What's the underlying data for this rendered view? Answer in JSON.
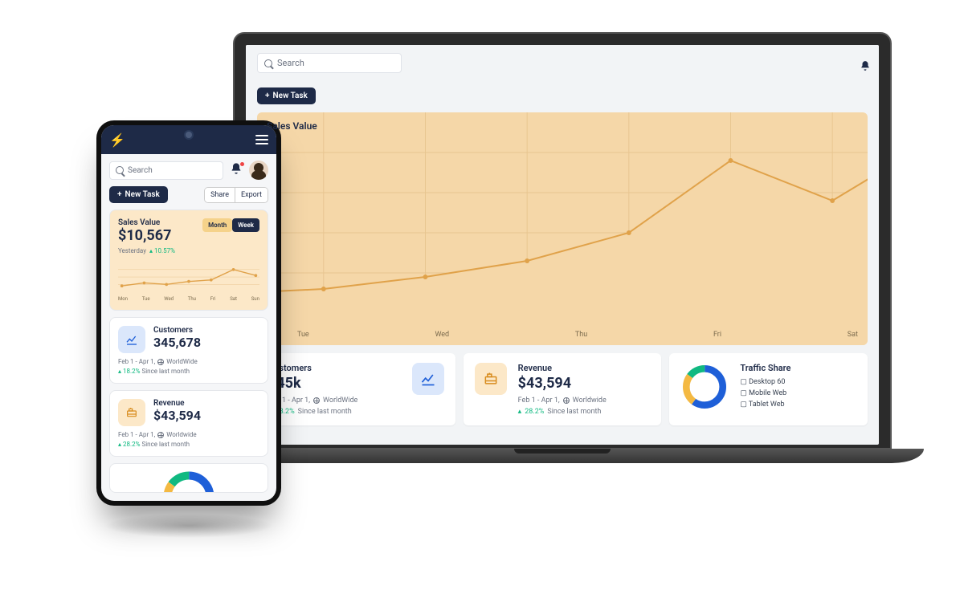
{
  "search_placeholder": "Search",
  "new_task_label": "New Task",
  "share_label": "Share",
  "export_label": "Export",
  "sales_value_title": "Sales Value",
  "sales_value_amount": "$10,567",
  "yesterday_label": "Yesterday",
  "yesterday_pct": "10.57%",
  "toggle_month": "Month",
  "toggle_week": "Week",
  "days_short": [
    "Mon",
    "Tue",
    "Wed",
    "Thu",
    "Fri",
    "Sat",
    "Sun"
  ],
  "days_laptop": [
    "Tue",
    "Wed",
    "Thu",
    "Fri",
    "Sat"
  ],
  "customers": {
    "label": "Customers",
    "value_phone": "345,678",
    "value_laptop": "345k",
    "range": "Feb 1 - Apr 1,",
    "scope": "WorldWide",
    "delta": "18.2%",
    "since": "Since last month"
  },
  "revenue": {
    "label": "Revenue",
    "value": "$43,594",
    "range": "Feb 1 - Apr 1,",
    "scope": "Worldwide",
    "delta": "28.2%",
    "since": "Since last month"
  },
  "traffic": {
    "label": "Traffic Share",
    "items": [
      "Desktop 60",
      "Mobile Web",
      "Tablet Web"
    ]
  },
  "chart_data": {
    "type": "line",
    "title": "Sales Value",
    "x": [
      "Mon",
      "Tue",
      "Wed",
      "Thu",
      "Fri",
      "Sat",
      "Sun"
    ],
    "values": [
      30,
      32,
      38,
      45,
      60,
      88,
      70
    ],
    "ylim": [
      0,
      100
    ]
  },
  "mini_chart_data": {
    "type": "line",
    "x": [
      "Mon",
      "Tue",
      "Wed",
      "Thu",
      "Fri",
      "Sat",
      "Sun"
    ],
    "values": [
      20,
      28,
      24,
      30,
      34,
      55,
      42
    ]
  },
  "donut_data": {
    "type": "pie",
    "series": [
      {
        "name": "Desktop",
        "value": 60,
        "color": "#1e5fd8"
      },
      {
        "name": "Mobile Web",
        "value": 25,
        "color": "#f4b942"
      },
      {
        "name": "Tablet Web",
        "value": 15,
        "color": "#10b981"
      }
    ]
  }
}
